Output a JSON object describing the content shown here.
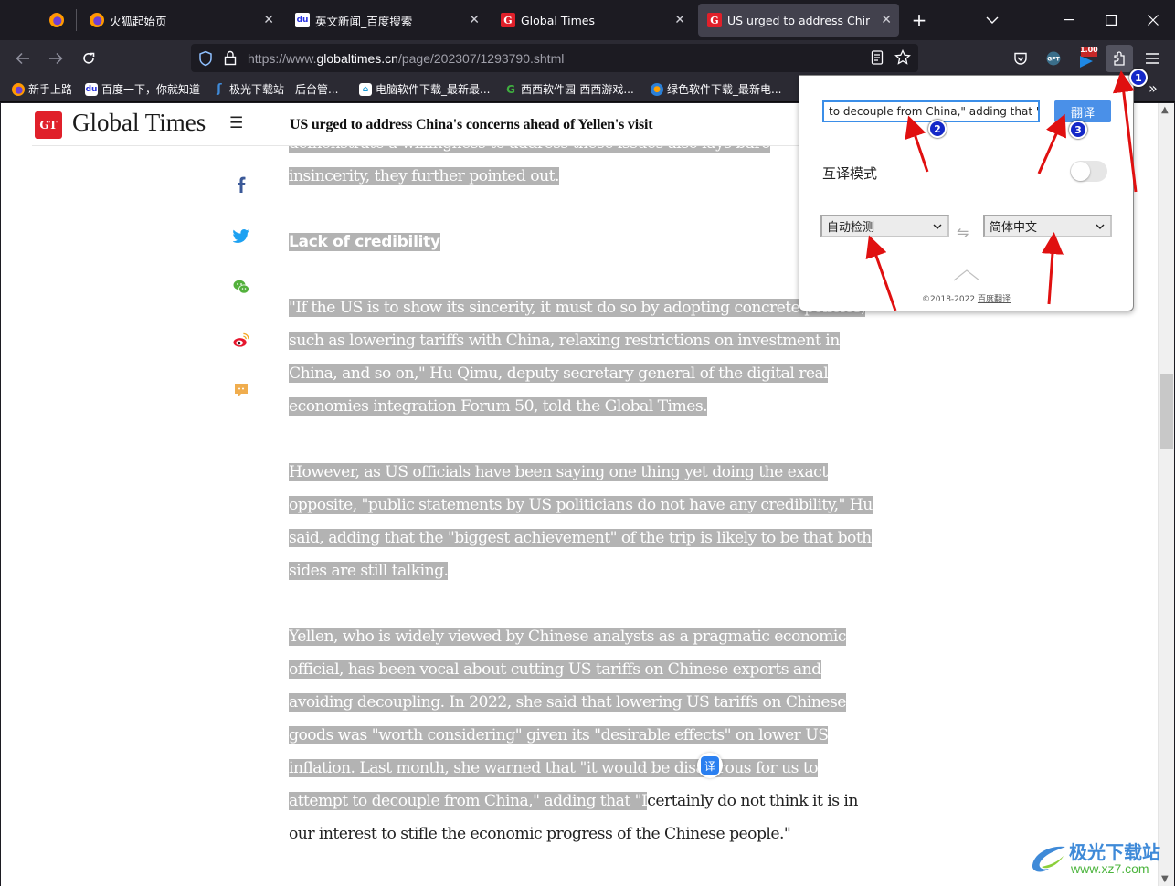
{
  "browser": {
    "tabs": [
      {
        "title": "",
        "icon": "firefox-icon",
        "pinned": true
      },
      {
        "title": "火狐起始页",
        "icon": "firefox-icon"
      },
      {
        "title": "英文新闻_百度搜索",
        "icon": "baidu-icon"
      },
      {
        "title": "Global Times",
        "icon": "globaltimes-icon"
      },
      {
        "title": "US urged to address China's concerns ahead of Yellen's visit",
        "icon": "globaltimes-icon",
        "active": true
      }
    ],
    "new_tab_symbol": "+",
    "url_host_prefix": "https://www.",
    "url_host": "globaltimes.cn",
    "url_path": "/page/202307/1293790.shtml",
    "extension_badge": "1.00",
    "bookmarks": [
      {
        "label": "新手上路",
        "icon": "firefox-icon"
      },
      {
        "label": "百度一下，你就知道",
        "icon": "baidu-icon"
      },
      {
        "label": "极光下载站 - 后台管...",
        "icon": "xz7-icon"
      },
      {
        "label": "电脑软件下载_最新最...",
        "icon": "house-icon"
      },
      {
        "label": "西西软件园-西西游戏...",
        "icon": "cr173-icon"
      },
      {
        "label": "绿色软件下载_最新电...",
        "icon": "greensoft-icon"
      }
    ]
  },
  "site": {
    "logo_mark": "GT",
    "logo_text": "Global Times",
    "header_title": "US urged to address China's concerns ahead of Yellen's visit"
  },
  "share_icons": [
    "facebook",
    "twitter",
    "wechat",
    "weibo",
    "comment"
  ],
  "article": {
    "lines": [
      {
        "text": "demonstrate a willingness to address these issues also lays bare",
        "selected": true
      },
      {
        "text": "insincerity, they further pointed out.",
        "selected": true
      },
      {
        "text": "Lack of credibility",
        "selected": true,
        "subhead": true
      },
      {
        "text": "\"If the US is to show its sincerity, it must do so by adopting concrete policies,",
        "selected": true
      },
      {
        "text": "such as lowering tariffs with China, relaxing restrictions on investment in",
        "selected": true
      },
      {
        "text": "China, and so on,\" Hu Qimu, deputy secretary general of the digital real",
        "selected": true
      },
      {
        "text": "economies integration Forum 50, told the Global Times.",
        "selected": true
      },
      {
        "text": "However, as US officials have been saying one thing yet doing the exact",
        "selected": true
      },
      {
        "text": "opposite, \"public statements by US politicians do not have any credibility,\" Hu",
        "selected": true
      },
      {
        "text": "said, adding that the \"biggest achievement\" of the trip is likely to be that both",
        "selected": true
      },
      {
        "text": "sides are still talking.",
        "selected": true
      },
      {
        "text": "Yellen, who is widely viewed by Chinese analysts as a pragmatic economic",
        "selected": true
      },
      {
        "text": "official, has been vocal about cutting US tariffs on Chinese exports and",
        "selected": true
      },
      {
        "text": "avoiding decoupling. In 2022, she said that lowering US tariffs on Chinese",
        "selected": true
      },
      {
        "text": "goods was \"worth considering\" given its \"desirable effects\" on lower US",
        "selected": true
      },
      {
        "text": "inflation. Last month, she warned that \"it would be disastrous for us to",
        "selected": true
      }
    ],
    "split_line": {
      "selected_part": "attempt to decouple from China,\" adding that \"I",
      "rest": "certainly do not think it is in"
    },
    "last_line": "our interest to stifle the economic progress of the Chinese people.\"",
    "translate_bubble": "译"
  },
  "popup": {
    "input_value": "to decouple from China,\" adding that \"I",
    "translate_button": "翻译",
    "mutual_mode_label": "互译模式",
    "mutual_mode_on": false,
    "source_lang": "自动检测",
    "target_lang": "简体中文",
    "swap_symbol": "⇋",
    "copyright": "©2018-2022",
    "brand_link": "百度翻译"
  },
  "annotations": [
    "1",
    "2",
    "3"
  ],
  "watermark": {
    "name": "极光下载站",
    "url": "www.xz7.com"
  },
  "colors": {
    "accent": "#4a90e8",
    "selection": "#b3b3b3",
    "gt_red": "#e0202a",
    "annotation_arrow": "#e01010",
    "annotation_badge": "#1428c8"
  }
}
